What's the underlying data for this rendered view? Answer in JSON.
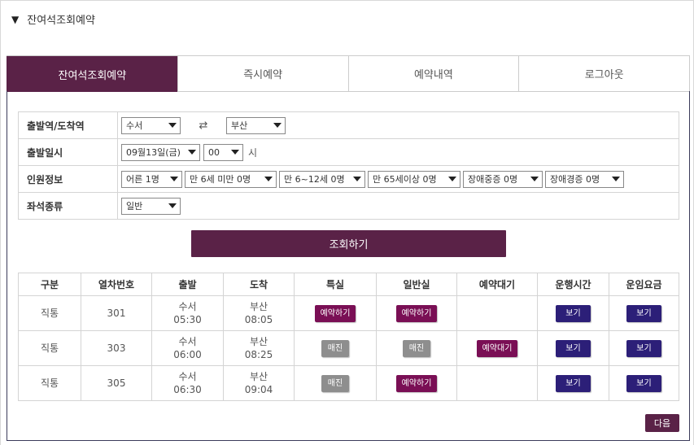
{
  "section": {
    "toggle_icon": "▼",
    "title": "잔여석조회예약"
  },
  "tabs": [
    {
      "label": "잔여석조회예약",
      "active": true
    },
    {
      "label": "즉시예약",
      "active": false
    },
    {
      "label": "예약내역",
      "active": false
    },
    {
      "label": "로그아웃",
      "active": false
    }
  ],
  "form": {
    "stations": {
      "label": "출발역/도착역",
      "departure": "수서",
      "arrival": "부산",
      "swap_icon": "⇄"
    },
    "datetime": {
      "label": "출발일시",
      "date": "09월13일(금)",
      "hour": "00",
      "hour_unit": "시"
    },
    "passengers": {
      "label": "인원정보",
      "adult": "어른 1명",
      "child_under6": "만 6세 미만 0명",
      "child_6_12": "만 6~12세 0명",
      "senior": "만 65세이상 0명",
      "disabled_severe": "장애중증 0명",
      "disabled_mild": "장애경증 0명"
    },
    "seat": {
      "label": "좌석종류",
      "value": "일반"
    }
  },
  "search_button": "조회하기",
  "results": {
    "headers": [
      "구분",
      "열차번호",
      "출발",
      "도착",
      "특실",
      "일반실",
      "예약대기",
      "운행시간",
      "운임요금"
    ],
    "rows": [
      {
        "type": "직통",
        "train_no": "301",
        "dep_station": "수서",
        "dep_time": "05:30",
        "arr_station": "부산",
        "arr_time": "08:05",
        "first": "예약하기",
        "general": "예약하기",
        "wait": "",
        "run_time": "보기",
        "fare": "보기"
      },
      {
        "type": "직통",
        "train_no": "303",
        "dep_station": "수서",
        "dep_time": "06:00",
        "arr_station": "부산",
        "arr_time": "08:25",
        "first": "매진",
        "general": "매진",
        "wait": "예약대기",
        "run_time": "보기",
        "fare": "보기"
      },
      {
        "type": "직통",
        "train_no": "305",
        "dep_station": "수서",
        "dep_time": "06:30",
        "arr_station": "부산",
        "arr_time": "09:04",
        "first": "매진",
        "general": "예약하기",
        "wait": "",
        "run_time": "보기",
        "fare": "보기"
      }
    ]
  },
  "next_button": "다음",
  "colors": {
    "primary": "#5a2247",
    "reserve": "#7a0f55",
    "soldout": "#8e8e8e",
    "view": "#2c1f78"
  }
}
